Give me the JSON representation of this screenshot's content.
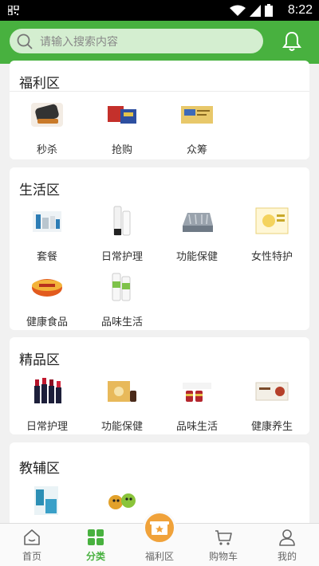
{
  "status_bar": {
    "time": "8:22"
  },
  "header": {
    "search_placeholder": "请输入搜索内容"
  },
  "sections": {
    "welfare": {
      "title": "福利区",
      "items": [
        {
          "label": "秒杀",
          "icon": "product-thumb"
        },
        {
          "label": "抢购",
          "icon": "product-thumb"
        },
        {
          "label": "众筹",
          "icon": "product-thumb"
        }
      ]
    },
    "life": {
      "title": "生活区",
      "items": [
        {
          "label": "套餐"
        },
        {
          "label": "日常护理"
        },
        {
          "label": "功能保健"
        },
        {
          "label": "女性特护"
        },
        {
          "label": "健康食品"
        },
        {
          "label": "品味生活"
        }
      ]
    },
    "premium": {
      "title": "精品区",
      "items": [
        {
          "label": "日常护理"
        },
        {
          "label": "功能保健"
        },
        {
          "label": "品味生活"
        },
        {
          "label": "健康养生"
        }
      ]
    },
    "tutoring": {
      "title": "教辅区",
      "items": [
        {
          "label": ""
        },
        {
          "label": ""
        }
      ]
    }
  },
  "bottom_nav": {
    "items": [
      {
        "label": "首页",
        "icon": "home-icon"
      },
      {
        "label": "分类",
        "icon": "category-icon",
        "active": true
      },
      {
        "label": "福利区",
        "icon": "gift-icon"
      },
      {
        "label": "购物车",
        "icon": "cart-icon"
      },
      {
        "label": "我的",
        "icon": "user-icon"
      }
    ]
  },
  "colors": {
    "brand_green": "#48b13f",
    "search_bg": "#d4eed0",
    "badge_orange": "#f0a23a"
  }
}
